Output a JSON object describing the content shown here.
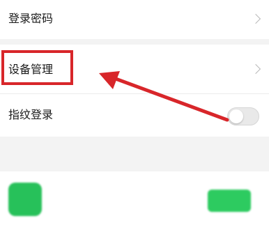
{
  "settings": {
    "login_password": "登录密码",
    "device_management": "设备管理",
    "fingerprint_login": "指纹登录",
    "fingerprint_enabled": false
  },
  "authorized_apps": {
    "section_title": "",
    "app_name": "",
    "app_subtitle": "",
    "action_label": ""
  },
  "annotation": {
    "highlight_color": "#d8262a",
    "arrow_color": "#d8262a"
  },
  "icons": {
    "chevron": "chevron-right-icon",
    "app": "wechat-icon"
  },
  "colors": {
    "background": "#f3f3f3",
    "card": "#ffffff",
    "wechat_green": "#27c15a"
  }
}
